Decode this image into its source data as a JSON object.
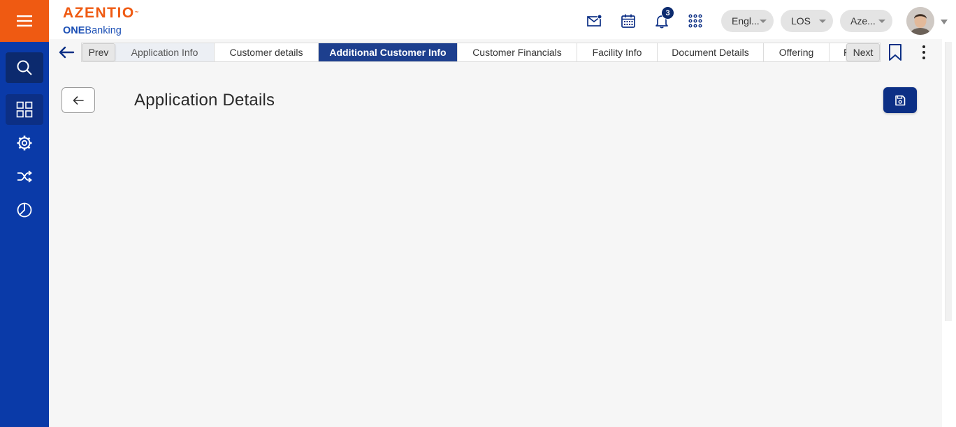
{
  "brand": {
    "name": "AZENTIO",
    "trademark": "™",
    "product_prefix": "ONE",
    "product_suffix": "Banking"
  },
  "colors": {
    "sidebar": "#0a3aa8",
    "menu_button": "#ef5a12",
    "active_tab": "#1d3f8e",
    "save_button": "#0c2f85"
  },
  "sidebar": {
    "items": [
      {
        "icon": "search-icon"
      },
      {
        "icon": "dashboard-icon"
      },
      {
        "icon": "gear-icon"
      },
      {
        "icon": "shuffle-icon"
      },
      {
        "icon": "pie-chart-icon"
      }
    ]
  },
  "header": {
    "icons": [
      "mail-icon",
      "calendar-icon",
      "bell-icon",
      "apps-grid-icon"
    ],
    "notification_count": "3",
    "language": "Engl...",
    "module": "LOS",
    "entity": "Aze..."
  },
  "tabs": {
    "prev_label": "Prev",
    "next_label": "Next",
    "items": [
      {
        "label": "Application Info",
        "state": "visited"
      },
      {
        "label": "Customer details",
        "state": "normal"
      },
      {
        "label": "Additional Customer Info",
        "state": "active"
      },
      {
        "label": "Customer Financials",
        "state": "normal"
      },
      {
        "label": "Facility Info",
        "state": "normal"
      },
      {
        "label": "Document Details",
        "state": "normal"
      },
      {
        "label": "Offering",
        "state": "normal"
      },
      {
        "label": "F",
        "state": "truncated"
      }
    ]
  },
  "page": {
    "title": "Application Details"
  }
}
